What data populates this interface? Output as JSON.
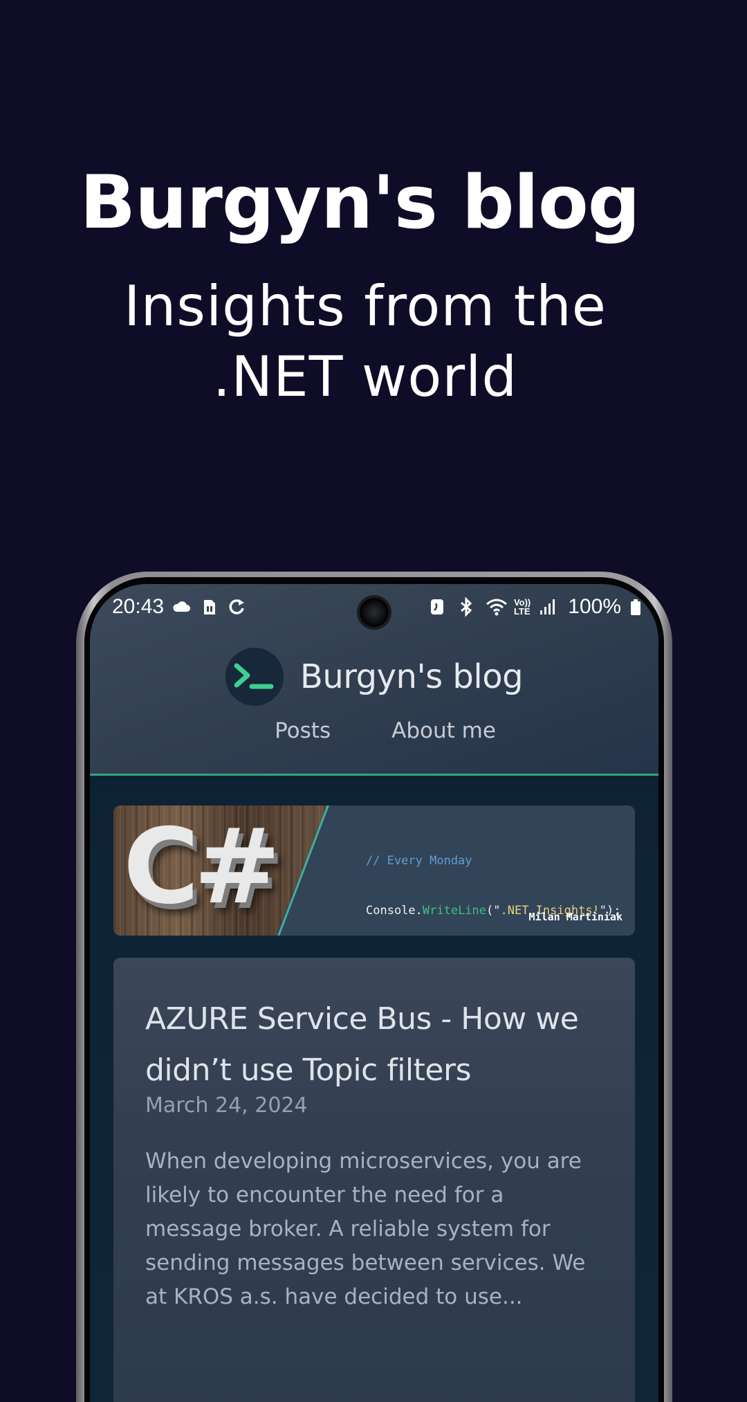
{
  "hero": {
    "title": "Burgyn's blog",
    "subtitle_line1": "Insights from the",
    "subtitle_line2": ".NET world"
  },
  "statusbar": {
    "time": "20:43",
    "battery": "100%",
    "left_icons": [
      "cloud-icon",
      "sim-card-icon",
      "sync-icon"
    ],
    "right_icons": [
      "nfc-icon",
      "bluetooth-icon",
      "wifi-icon",
      "volte-icon",
      "signal-icon",
      "battery-icon"
    ],
    "volte_label_top": "Vo))",
    "volte_label_bottom": "LTE"
  },
  "app": {
    "brand_name": "Burgyn's blog",
    "nav": [
      {
        "label": "Posts"
      },
      {
        "label": "About me"
      }
    ],
    "accent_color": "#2fa67c"
  },
  "banner": {
    "logo_text": "C#",
    "code_comment": "// Every Monday",
    "code_object": "Console.",
    "code_method": "WriteLine",
    "code_open": "(\"",
    "code_string": ".NET Insights!",
    "code_close": "\");",
    "author": "Milan Martiniak"
  },
  "post": {
    "title": "AZURE Service Bus - How we didn’t use Topic filters",
    "date": "March 24, 2024",
    "excerpt": "When developing microservices, you are likely to encounter the need for a message broker. A reliable system for sending messages between services. We at KROS a.s. have decided to use..."
  }
}
